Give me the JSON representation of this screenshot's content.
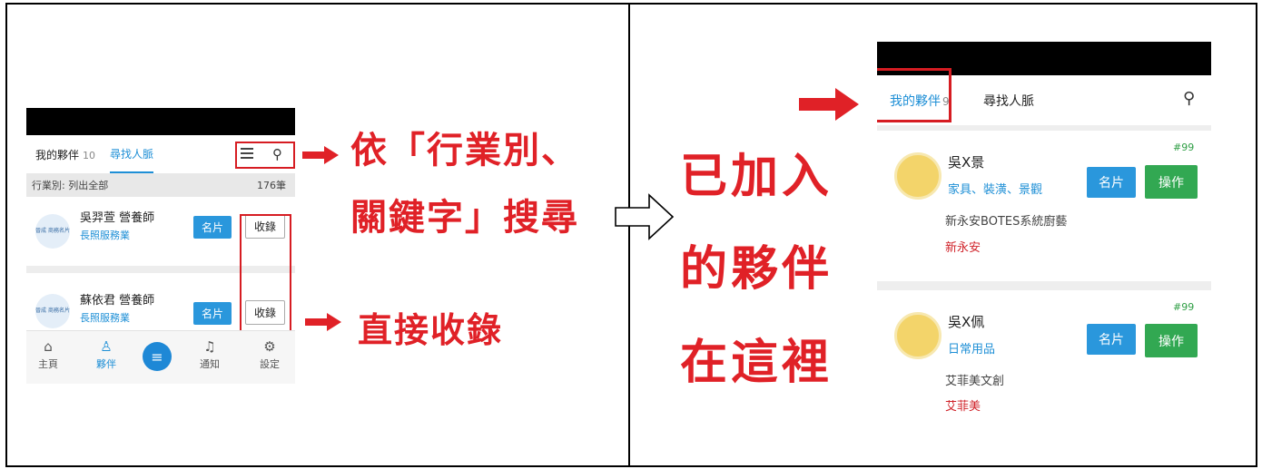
{
  "left_phone": {
    "tabs": {
      "my_partners": "我的夥伴",
      "my_partners_count": "10",
      "find_contacts": "尋找人脈"
    },
    "filter": {
      "label": "行業別: 列出全部",
      "count": "176筆"
    },
    "cards": [
      {
        "avatar_text": "晉成 商務名片",
        "name": "吳羿萱 營養師",
        "industry": "長照服務業",
        "card_btn": "名片",
        "collect_btn": "收錄"
      },
      {
        "avatar_text": "晉成 商務名片",
        "name": "蘇依君 營養師",
        "industry": "長照服務業",
        "card_btn": "名片",
        "collect_btn": "收錄"
      }
    ],
    "nav": {
      "home": "主頁",
      "partners": "夥伴",
      "notify": "通知",
      "settings": "設定"
    }
  },
  "annotations": {
    "search_line1": "依「行業別、",
    "search_line2": "關鍵字」搜尋",
    "collect": "直接收錄",
    "joined_line1": "已加入",
    "joined_line2": "的夥伴",
    "joined_line3": "在這裡"
  },
  "right_phone": {
    "tabs": {
      "my_partners": "我的夥伴",
      "my_partners_count": "9",
      "find_contacts": "尋找人脈"
    },
    "cards": [
      {
        "name": "吳X景",
        "industry": "家具、裝潢、景觀",
        "company": "新永安BOTES系統廚藝",
        "brand": "新永安",
        "number": "#99",
        "card_btn": "名片",
        "op_btn": "操作"
      },
      {
        "name": "吳X佩",
        "industry": "日常用品",
        "company": "艾菲美文創",
        "brand": "艾菲美",
        "number": "#99",
        "card_btn": "名片",
        "op_btn": "操作"
      }
    ]
  },
  "colors": {
    "accent": "#1e8fd6",
    "annotation_red": "#e02127",
    "operate_green": "#32a852"
  }
}
